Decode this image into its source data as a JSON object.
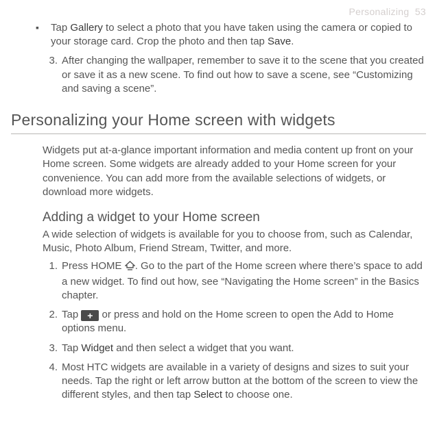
{
  "running_head": {
    "section": "Personalizing",
    "page": "53"
  },
  "top_bullet": {
    "pre": "Tap ",
    "gallery": "Gallery",
    "mid": " to select a photo that you have taken using the camera or copied to your storage card. Crop the photo and then tap ",
    "save": "Save",
    "post": "."
  },
  "step3_top": {
    "num": "3.",
    "text": "After changing the wallpaper, remember to save it to the scene that you created or save it as a new scene. To find out how to save a scene, see “Customizing and saving a scene”."
  },
  "heading": "Personalizing your Home screen with widgets",
  "intro": "Widgets put at-a-glance important information and media content up front on your Home screen. Some widgets are already added to your Home screen for your convenience. You can add more from the available selections of widgets, or download more widgets.",
  "subheading": "Adding a widget to your Home screen",
  "subintro": "A wide selection of widgets is available for you to choose from, such as Calendar, Music, Photo Album, Friend Stream, Twitter, and more.",
  "steps": [
    {
      "num": "1.",
      "pre": "Press HOME ",
      "post": ". Go to the part of the Home screen where there’s space to add a new widget. To find out how, see “Navigating the Home screen” in the Basics chapter."
    },
    {
      "num": "2.",
      "pre": "Tap ",
      "post": " or press and hold on the Home screen to open the Add to Home options menu."
    },
    {
      "num": "3.",
      "pre": "Tap ",
      "widget": "Widget",
      "post": " and then select a widget that you want."
    },
    {
      "num": "4.",
      "pre": "Most HTC widgets are available in a variety of designs and sizes to suit your needs. Tap the right or left arrow button at the bottom of the screen to view the different styles, and then tap ",
      "select": "Select",
      "post": " to choose one."
    }
  ],
  "icons": {
    "plus_glyph": "+"
  }
}
